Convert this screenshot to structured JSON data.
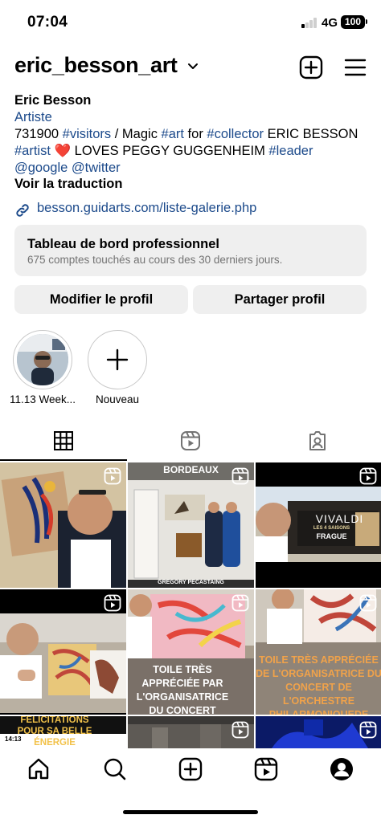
{
  "status_bar": {
    "time": "07:04",
    "network": "4G",
    "battery": "100"
  },
  "header": {
    "username": "eric_besson_art"
  },
  "bio": {
    "name": "Eric Besson",
    "category": "Artiste",
    "line1": {
      "a": "731900 ",
      "t1": "#visitors",
      "b": " / Magic ",
      "t2": "#art",
      "c": " for ",
      "t3": "#collector",
      "d": " ERIC BESSON"
    },
    "line2": {
      "t1": "#artist",
      "heart": "❤️",
      "a": " LOVES  PEGGY GUGGENHEIM ",
      "t2": "#leader"
    },
    "line3": {
      "t1": "@google",
      "sep": " ",
      "t2": "@twitter"
    },
    "translate": "Voir la traduction",
    "link": "besson.guidarts.com/liste-galerie.php"
  },
  "dashboard": {
    "title": "Tableau de bord professionnel",
    "subtitle": "675 comptes touchés au cours des 30 derniers jours."
  },
  "buttons": {
    "edit": "Modifier le profil",
    "share": "Partager profil"
  },
  "highlights": [
    {
      "label": "11.13 Week..."
    },
    {
      "label": "Nouveau"
    }
  ],
  "tabs": [
    "posts-grid-icon",
    "reels-icon",
    "tagged-icon"
  ],
  "posts": {
    "p2_top": "BORDEAUX",
    "p2_caption": "GREGORY PECASTAING",
    "p3_title": "VIVALDI",
    "p3_sub": "LES 4 SAISONS",
    "p3_sub2": "FRAGUE",
    "p5_text": "TOILE TRÈS APPRÉCIÉE PAR L'ORGANISATRICE DU CONCERT OFFICIÉ PAR L'ORCHESTRE",
    "p6_text": "TOILE TRÈS APPRÉCIÉE DE L'ORGANISATRICE DU CONCERT DE L'ORCHESTRE PHILARMONIQUEDE",
    "p7_text": "FÉLICITATIONS POUR SA BELLE ÉNERGIE",
    "p7_time": "14:13"
  },
  "nav": [
    "home-icon",
    "search-icon",
    "create-icon",
    "reels-icon",
    "profile-icon"
  ],
  "colors": {
    "link": "#1c4a8b",
    "card_bg": "#efefef",
    "muted": "#737373"
  }
}
